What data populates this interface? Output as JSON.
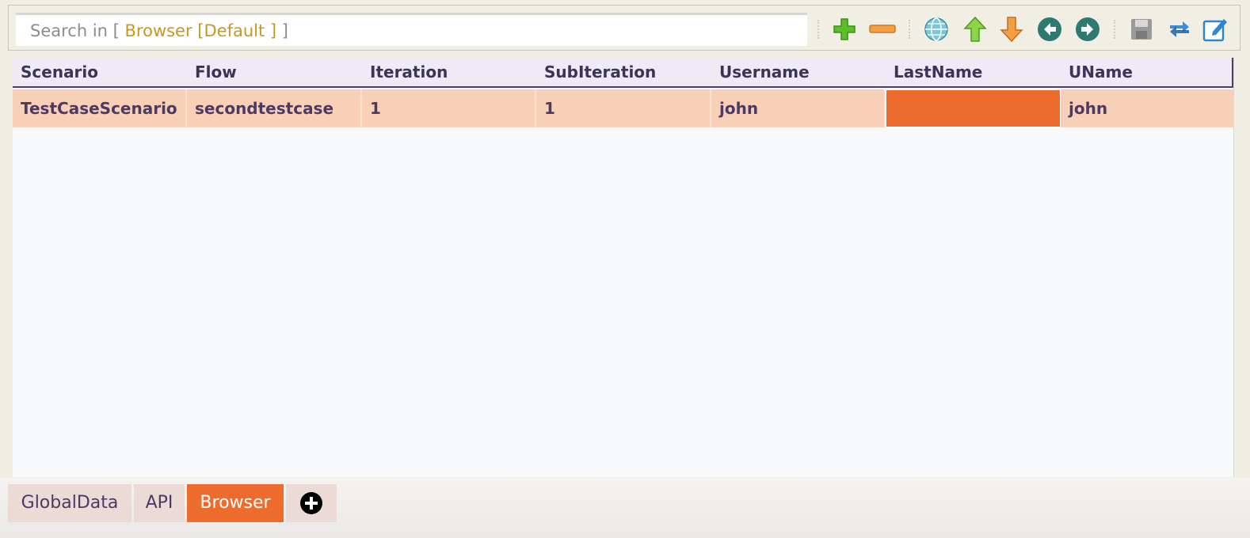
{
  "search": {
    "prefix": "Search in [ ",
    "scope": "Browser [Default ]",
    "suffix": " ]"
  },
  "toolbar": {
    "icons": [
      "add-icon",
      "remove-icon",
      "globe-icon",
      "move-up-icon",
      "move-down-icon",
      "arrow-left-icon",
      "arrow-right-icon",
      "save-icon",
      "swap-icon",
      "edit-icon"
    ]
  },
  "table": {
    "columns": [
      "Scenario",
      "Flow",
      "Iteration",
      "SubIteration",
      "Username",
      "LastName",
      "UName"
    ],
    "rows": [
      [
        "TestCaseScenario",
        "secondtestcase",
        "1",
        "1",
        "john",
        "",
        "john"
      ]
    ]
  },
  "tabs": [
    {
      "label": "GlobalData",
      "active": false
    },
    {
      "label": "API",
      "active": false
    },
    {
      "label": "Browser",
      "active": true
    }
  ],
  "colors": {
    "accent": "#ec6b2d",
    "row_highlight": "#f8d0b8",
    "header_bg": "#eeebf7",
    "text": "#4b3a66",
    "scope_text": "#c49a1e"
  }
}
